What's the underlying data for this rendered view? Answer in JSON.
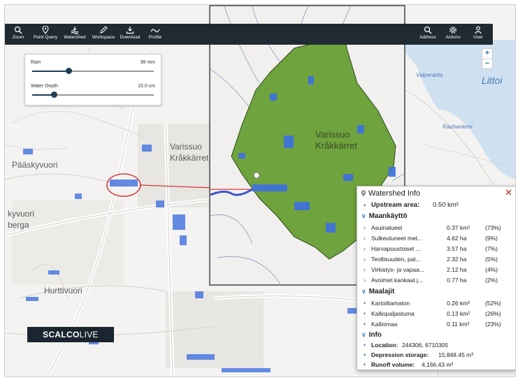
{
  "toolbar": {
    "left_tools": [
      {
        "label": "Zoom",
        "icon": "search-icon"
      },
      {
        "label": "Point Query",
        "icon": "map-pin-icon"
      },
      {
        "label": "Watershed",
        "icon": "watershed-icon"
      },
      {
        "label": "Workspace",
        "icon": "pencil-icon"
      },
      {
        "label": "Download",
        "icon": "download-icon"
      },
      {
        "label": "Profile",
        "icon": "profile-icon"
      }
    ],
    "right_tools": [
      {
        "label": "Address",
        "icon": "address-search-icon"
      },
      {
        "label": "Actions",
        "icon": "gear-icon"
      },
      {
        "label": "User",
        "icon": "user-icon"
      }
    ]
  },
  "zoom": {
    "plus": "+",
    "minus": "−"
  },
  "sliders": {
    "rain": {
      "label": "Rain",
      "value_text": "38 mm",
      "fraction": 0.3
    },
    "water_depth": {
      "label": "Water Depth",
      "value_text": "15.0 cm",
      "fraction": 0.18
    }
  },
  "map_labels": {
    "varissuo": "Varissuo",
    "krakkarret": "Kråkkärret",
    "paaskyvuori": "Pääskyvuori",
    "kyvuori": "kyvuori",
    "berga": "berga",
    "hurttivuori": "Hurttivuori",
    "valperaanta": "Valperanta",
    "littoi": "Littoi",
    "rauhaniemi": "Rauhaniemi",
    "inset_varissuo": "Varissuo",
    "inset_krakkarret": "Kråkkärret"
  },
  "logo": {
    "part1": "SCALCO",
    "part2": "LIVE"
  },
  "watershed_info": {
    "title": "Watershed Info",
    "close": "✕",
    "upstream_label": "Upstream area:",
    "upstream_value": "0.50 km²",
    "landuse_title": "Maankäyttö",
    "landuse": [
      {
        "name": "Asuinalueet",
        "value": "0.37 km²",
        "pct": "(73%)"
      },
      {
        "name": "Sulkeutuneet met...",
        "value": "4.62 ha",
        "pct": "(9%)"
      },
      {
        "name": "Harvapuustoiset ...",
        "value": "3.57 ha",
        "pct": "(7%)"
      },
      {
        "name": "Teollisuuden, pal...",
        "value": "2.32 ha",
        "pct": "(5%)"
      },
      {
        "name": "Virkistys- ja vapaa...",
        "value": "2.12 ha",
        "pct": "(4%)"
      },
      {
        "name": "Avoimet kankaat j...",
        "value": "0.77 ha",
        "pct": "(2%)"
      }
    ],
    "soil_title": "Maalajit",
    "soil": [
      {
        "name": "Kartoittamaton",
        "value": "0.26 km²",
        "pct": "(52%)"
      },
      {
        "name": "Kalliopaljastuma",
        "value": "0.13 km²",
        "pct": "(26%)"
      },
      {
        "name": "Kalliomaa",
        "value": "0.11 km²",
        "pct": "(23%)"
      }
    ],
    "info_title": "Info",
    "location_label": "Location:",
    "location_value": "244306, 6710305",
    "depression_label": "Depression storage:",
    "depression_value": "15,848.45 m³",
    "runoff_label": "Runoff volume:",
    "runoff_value": "4,166.43 m³"
  },
  "colors": {
    "toolbar_bg": "#1f2a33",
    "watershed_fill": "#6fa33d",
    "flood_blue": "#3d6fe0",
    "highlight_red": "#d23a3a",
    "accent_blue": "#3f7ebf"
  }
}
